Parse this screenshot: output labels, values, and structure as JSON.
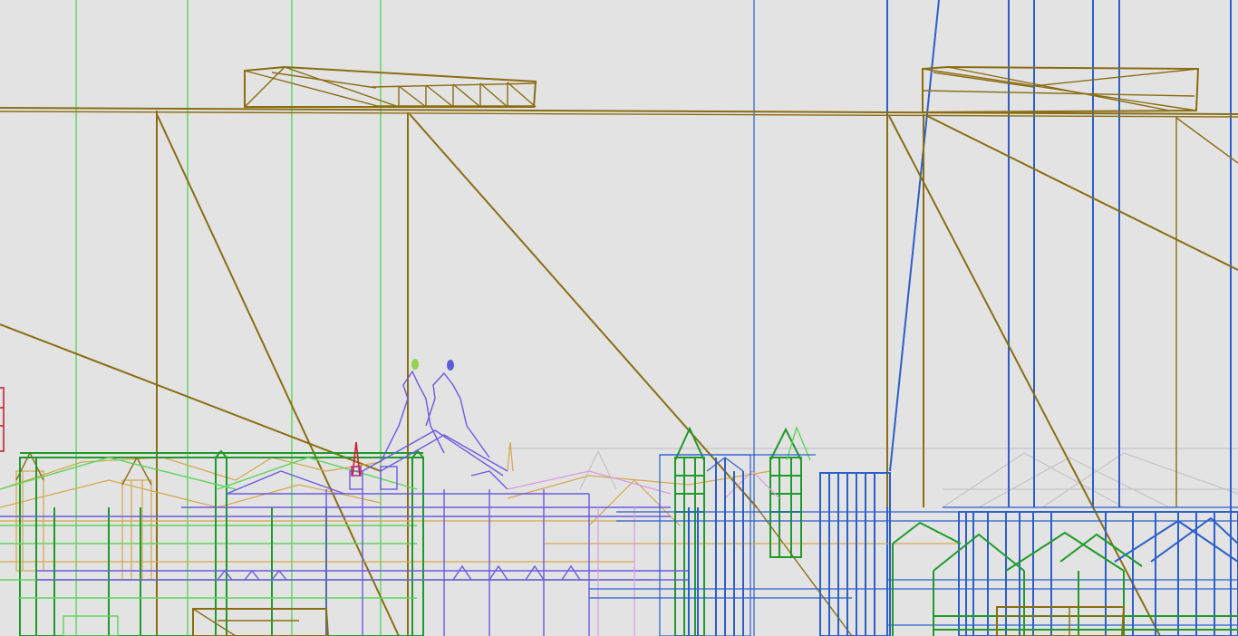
{
  "scene": {
    "background_color": "#e3e3e4",
    "colors": {
      "bridge_truss": "#8a6d12",
      "blue_structure": "#2b5fc9",
      "green_structure": "#1f9a2a",
      "light_green": "#5fd45a",
      "purple_structure": "#6a5be0",
      "tan_structure": "#d4a74a",
      "pink_structure": "#d79be0",
      "grey_structure": "#c4c4c8",
      "red_marker": "#c4232d"
    }
  }
}
